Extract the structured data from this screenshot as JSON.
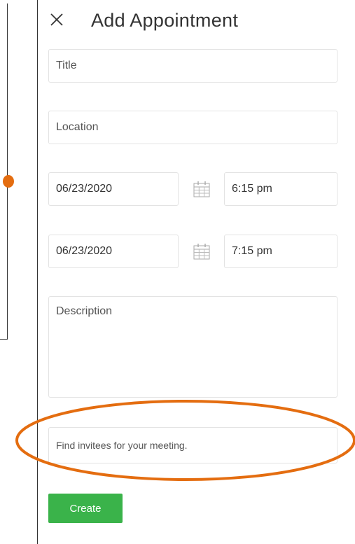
{
  "dialog": {
    "title": "Add Appointment",
    "close_icon": "close-icon",
    "fields": {
      "title": {
        "placeholder": "Title"
      },
      "location": {
        "placeholder": "Location"
      },
      "start_date": {
        "value": "06/23/2020"
      },
      "start_time": {
        "value": "6:15 pm"
      },
      "end_date": {
        "value": "06/23/2020"
      },
      "end_time": {
        "value": "7:15 pm"
      },
      "description": {
        "placeholder": "Description"
      },
      "invitees": {
        "placeholder": "Find invitees for your meeting."
      }
    },
    "create_label": "Create"
  },
  "colors": {
    "create_button": "#3ab34a",
    "highlight": "#e46d10",
    "field_border": "#e3e3e3"
  }
}
